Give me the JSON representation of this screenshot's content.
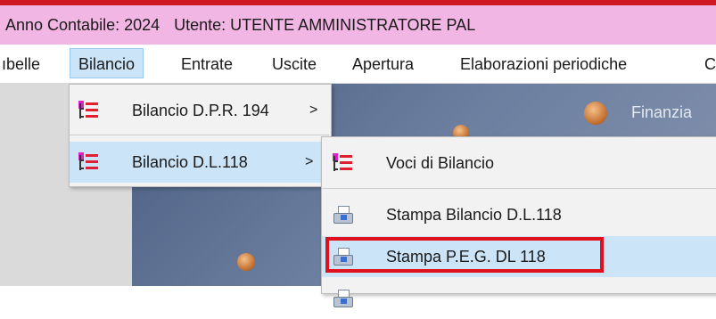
{
  "title_bar": {
    "year_text": "Anno Contabile: 2024",
    "user_text": "Utente: UTENTE AMMINISTRATORE PAL"
  },
  "menu": {
    "items": [
      "ıbelle",
      "Bilancio",
      "Entrate",
      "Uscite",
      "Apertura",
      "Elaborazioni periodiche",
      "C"
    ],
    "active": "Bilancio"
  },
  "background": {
    "finanza_text": "Finanzia"
  },
  "bilancio_menu": {
    "items": [
      {
        "label": "Bilancio D.P.R. 194",
        "arrow": ">",
        "icon": "list-tree-icon"
      },
      {
        "label": "Bilancio D.L.118",
        "arrow": ">",
        "icon": "list-tree-icon",
        "highlighted": true
      }
    ]
  },
  "dl118_submenu": {
    "items": [
      {
        "label": "Voci di Bilancio",
        "icon": "list-tree-icon"
      },
      {
        "label": "Stampa Bilancio D.L.118",
        "icon": "printer-icon"
      },
      {
        "label": "Stampa P.E.G.  DL 118",
        "icon": "printer-icon",
        "highlighted": true
      }
    ]
  },
  "colors": {
    "title_bg": "#f1b6e3",
    "highlight": "#cce4f7",
    "annotation_red": "#e0101c"
  }
}
